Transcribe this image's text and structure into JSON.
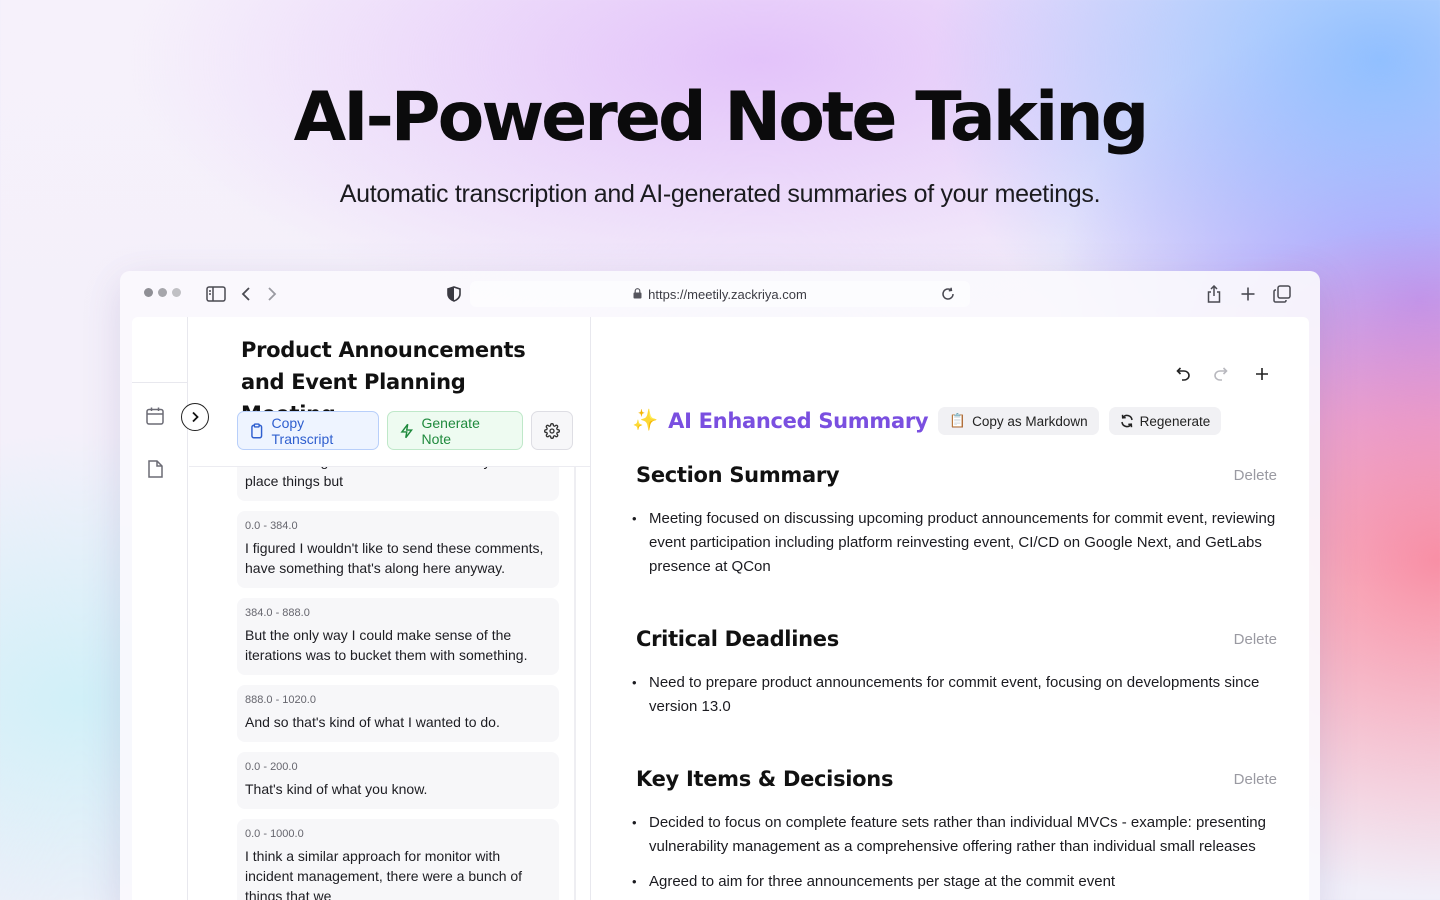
{
  "hero": {
    "title": "AI-Powered Note Taking",
    "subtitle": "Automatic transcription and AI-generated summaries of your meetings."
  },
  "browser": {
    "url": "https://meetily.zackriya.com"
  },
  "transcript": {
    "title": "Product Announcements and Event Planning Meeting",
    "copy_label": "Copy Transcript",
    "generate_label": "Generate Note",
    "partial_text": "three exciting level I wasn't sure exactly where to place things but",
    "items": [
      {
        "time": "0.0 - 384.0",
        "text": "I figured I wouldn't like to send these comments, have something that's along here anyway."
      },
      {
        "time": "384.0 - 888.0",
        "text": "But the only way I could make sense of the iterations was to bucket them with something."
      },
      {
        "time": "888.0 - 1020.0",
        "text": "And so that's kind of what I wanted to do."
      },
      {
        "time": "0.0 - 200.0",
        "text": "That's kind of what you know."
      },
      {
        "time": "0.0 - 1000.0",
        "text": "I think a similar approach for monitor with incident management, there were a bunch of things that we"
      }
    ]
  },
  "summary": {
    "title": "AI Enhanced Summary",
    "sparkle": "✨",
    "copy_markdown_label": "Copy as Markdown",
    "copy_markdown_icon": "📋",
    "regenerate_label": "Regenerate",
    "delete_label": "Delete",
    "sections": [
      {
        "title": "Section Summary",
        "bullets": [
          "Meeting focused on discussing upcoming product announcements for commit event, reviewing event participation including platform reinvesting event, CI/CD on Google Next, and GetLabs presence at QCon"
        ]
      },
      {
        "title": "Critical Deadlines",
        "bullets": [
          "Need to prepare product announcements for commit event, focusing on developments since version 13.0"
        ]
      },
      {
        "title": "Key Items & Decisions",
        "bullets": [
          "Decided to focus on complete feature sets rather than individual MVCs - example: presenting vulnerability management as a comprehensive offering rather than individual small releases",
          "Agreed to aim for three announcements per stage at the commit event"
        ]
      }
    ]
  },
  "colors": {
    "accent_purple": "#7a4fe0",
    "copy_blue": "#2f5fcf",
    "generate_green": "#1f8a3d"
  }
}
